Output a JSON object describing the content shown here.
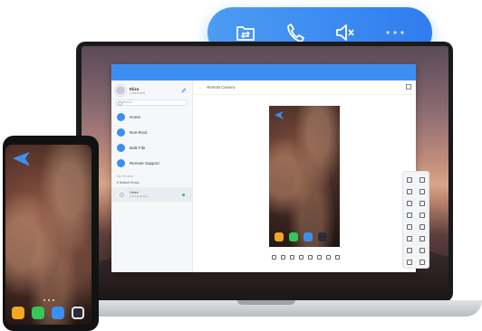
{
  "toolbar": {
    "items": [
      {
        "icon": "file-transfer-icon"
      },
      {
        "icon": "phone-call-icon"
      },
      {
        "icon": "mute-speaker-icon"
      },
      {
        "icon": "more-icon",
        "label": "···"
      }
    ]
  },
  "app": {
    "user": {
      "name": "Eliza",
      "status": "Connected"
    },
    "search_placeholder": "Search",
    "nav": [
      {
        "label": "Home",
        "icon": "home-icon"
      },
      {
        "label": "Non-Root",
        "icon": "non-root-icon"
      },
      {
        "label": "Bulk File",
        "icon": "bulk-file-icon"
      },
      {
        "label": "Remote Support",
        "icon": "remote-support-icon"
      }
    ],
    "section_label": "My Devices",
    "group_label": "Default Group",
    "device": {
      "name": "Helen",
      "sub": "Android Device"
    },
    "breadcrumb": "Remote Camera"
  },
  "colors": {
    "accent": "#3d8ef3",
    "pill_start": "#4c9cf3",
    "pill_end": "#2f7df0",
    "online": "#3bb76a"
  },
  "dock_colors": [
    "#f6a623",
    "#34c759",
    "#3d8ef3",
    "#2b2b3a"
  ]
}
